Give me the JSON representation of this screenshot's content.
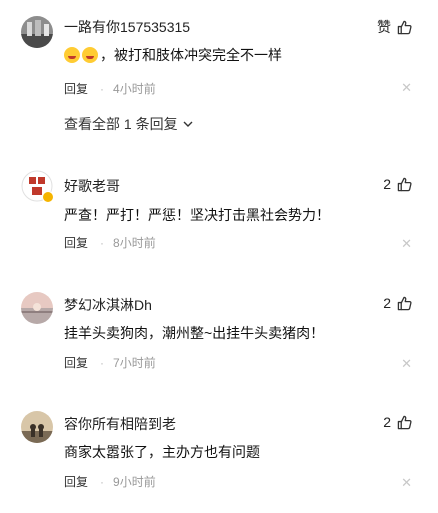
{
  "comments": [
    {
      "username": "一路有你157535315",
      "like_label": "赞",
      "emoji_icons": [
        "laughing-crying-emoji",
        "laughing-crying-emoji"
      ],
      "text": "，被打和肢体冲突完全不一样",
      "reply_label": "回复",
      "time": "4小时前",
      "view_all": "查看全部 1 条回复"
    },
    {
      "username": "好歌老哥",
      "like_count": "2",
      "text": "严查！严打！严惩！坚决打击黑社会势力！",
      "reply_label": "回复",
      "time": "8小时前"
    },
    {
      "username": "梦幻冰淇淋Dh",
      "like_count": "2",
      "text": "挂羊头卖狗肉，潮州整~出挂牛头卖猪肉！",
      "reply_label": "回复",
      "time": "7小时前"
    },
    {
      "username": "容你所有相陪到老",
      "like_count": "2",
      "text": "商家太嚣张了，主办方也有问题",
      "reply_label": "回复",
      "time": "9小时前"
    }
  ],
  "icons": {
    "like": "thumbs-up-icon",
    "close": "close-icon",
    "expand": "chevron-down-icon"
  },
  "colors": {
    "text": "#222222",
    "muted": "#999999",
    "badge": "#f5b400"
  }
}
